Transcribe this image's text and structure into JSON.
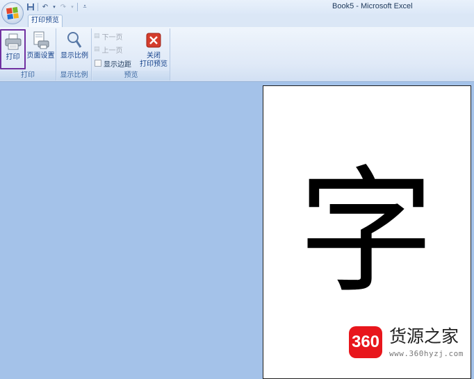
{
  "window": {
    "title": "Book5 - Microsoft Excel"
  },
  "quick_access": {
    "icons": [
      "save-icon",
      "undo-icon",
      "redo-icon",
      "customize-icon"
    ]
  },
  "tabs": [
    {
      "label": "打印预览"
    }
  ],
  "ribbon": {
    "groups": [
      {
        "label": "打印",
        "buttons": [
          {
            "label": "打印",
            "icon": "printer-icon"
          },
          {
            "label": "页面设置",
            "icon": "page-setup-icon"
          }
        ]
      },
      {
        "label": "显示比例",
        "buttons": [
          {
            "label": "显示比例",
            "icon": "zoom-icon"
          }
        ]
      },
      {
        "label": "预览",
        "small_buttons": [
          {
            "label": "下一页",
            "icon": "next-page-icon",
            "enabled": false
          },
          {
            "label": "上一页",
            "icon": "prev-page-icon",
            "enabled": false
          }
        ],
        "checkbox": {
          "label": "显示边距",
          "checked": false
        },
        "close": {
          "label_line1": "关闭",
          "label_line2": "打印预览",
          "icon": "close-preview-icon"
        }
      }
    ]
  },
  "preview": {
    "cell_text": "字"
  },
  "watermark": {
    "logo_text": "360",
    "name": "货源之家",
    "url": "www.360hyzj.com"
  },
  "colors": {
    "ribbon_text": "#15428b",
    "workarea_bg": "#a4c2e9",
    "highlight_border": "#7030a0",
    "close_red": "#d43c2c",
    "watermark_red": "#e8161c"
  }
}
